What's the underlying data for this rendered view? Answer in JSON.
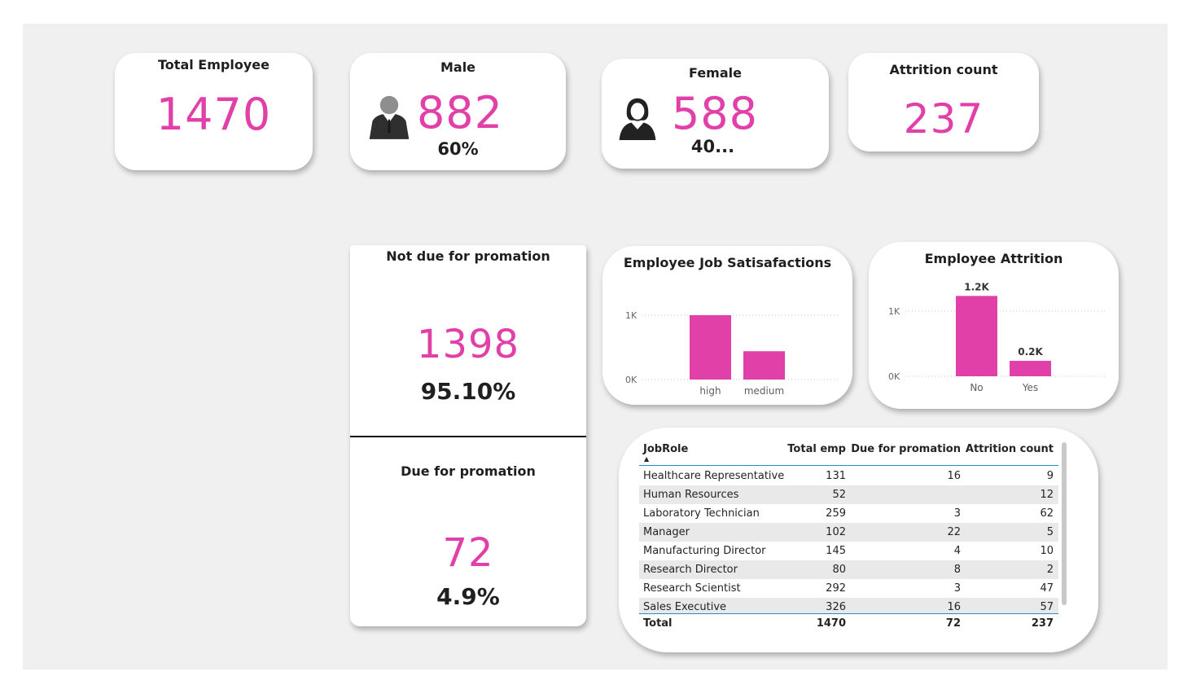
{
  "colors": {
    "accent": "#e040a8",
    "canvas": "#f0f0f0",
    "table_rule": "#1f8fd6"
  },
  "kpis": {
    "total": {
      "title": "Total Employee",
      "value": "1470"
    },
    "male": {
      "title": "Male",
      "value": "882",
      "pct": "60%",
      "icon": "male-person-icon"
    },
    "female": {
      "title": "Female",
      "value": "588",
      "pct": "40...",
      "icon": "female-person-icon"
    },
    "attrition": {
      "title": "Attrition count",
      "value": "237"
    }
  },
  "promotion": {
    "not_due": {
      "title": "Not due for promation",
      "value": "1398",
      "pct": "95.10%"
    },
    "due": {
      "title": "Due for promation",
      "value": "72",
      "pct": "4.9%"
    }
  },
  "chart_data": [
    {
      "type": "bar",
      "title": "Employee Job Satisafactions",
      "categories": [
        "high",
        "medium"
      ],
      "values": [
        1000,
        440
      ],
      "ylim": [
        0,
        1000
      ],
      "yticks": [
        "0K",
        "1K"
      ],
      "grid": true,
      "color": "#e040a8"
    },
    {
      "type": "bar",
      "title": "Employee Attrition",
      "categories": [
        "No",
        "Yes"
      ],
      "values": [
        1233,
        237
      ],
      "data_labels": [
        "1.2K",
        "0.2K"
      ],
      "ylim": [
        0,
        1000
      ],
      "yticks": [
        "0K",
        "1K"
      ],
      "grid": true,
      "color": "#e040a8"
    }
  ],
  "table": {
    "headers": [
      "JobRole",
      "Total emp",
      "Due for promation",
      "Attrition count"
    ],
    "sort_indicator": "▲",
    "rows": [
      [
        "Healthcare Representative",
        "131",
        "16",
        "9"
      ],
      [
        "Human Resources",
        "52",
        "",
        "12"
      ],
      [
        "Laboratory Technician",
        "259",
        "3",
        "62"
      ],
      [
        "Manager",
        "102",
        "22",
        "5"
      ],
      [
        "Manufacturing Director",
        "145",
        "4",
        "10"
      ],
      [
        "Research Director",
        "80",
        "8",
        "2"
      ],
      [
        "Research Scientist",
        "292",
        "3",
        "47"
      ],
      [
        "Sales Executive",
        "326",
        "16",
        "57"
      ]
    ],
    "total": [
      "Total",
      "1470",
      "72",
      "237"
    ]
  }
}
